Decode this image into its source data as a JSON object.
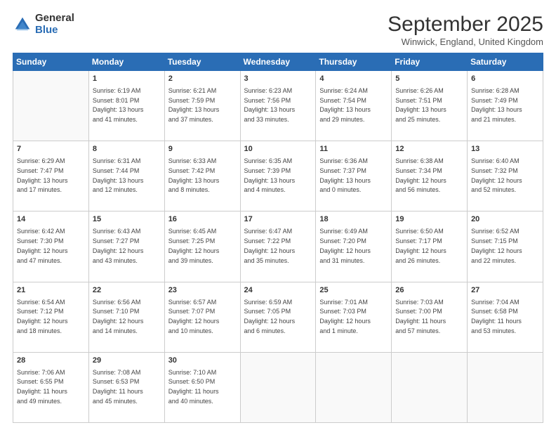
{
  "logo": {
    "general": "General",
    "blue": "Blue"
  },
  "header": {
    "month": "September 2025",
    "location": "Winwick, England, United Kingdom"
  },
  "days_header": [
    "Sunday",
    "Monday",
    "Tuesday",
    "Wednesday",
    "Thursday",
    "Friday",
    "Saturday"
  ],
  "weeks": [
    [
      {
        "day": "",
        "info": ""
      },
      {
        "day": "1",
        "info": "Sunrise: 6:19 AM\nSunset: 8:01 PM\nDaylight: 13 hours\nand 41 minutes."
      },
      {
        "day": "2",
        "info": "Sunrise: 6:21 AM\nSunset: 7:59 PM\nDaylight: 13 hours\nand 37 minutes."
      },
      {
        "day": "3",
        "info": "Sunrise: 6:23 AM\nSunset: 7:56 PM\nDaylight: 13 hours\nand 33 minutes."
      },
      {
        "day": "4",
        "info": "Sunrise: 6:24 AM\nSunset: 7:54 PM\nDaylight: 13 hours\nand 29 minutes."
      },
      {
        "day": "5",
        "info": "Sunrise: 6:26 AM\nSunset: 7:51 PM\nDaylight: 13 hours\nand 25 minutes."
      },
      {
        "day": "6",
        "info": "Sunrise: 6:28 AM\nSunset: 7:49 PM\nDaylight: 13 hours\nand 21 minutes."
      }
    ],
    [
      {
        "day": "7",
        "info": "Sunrise: 6:29 AM\nSunset: 7:47 PM\nDaylight: 13 hours\nand 17 minutes."
      },
      {
        "day": "8",
        "info": "Sunrise: 6:31 AM\nSunset: 7:44 PM\nDaylight: 13 hours\nand 12 minutes."
      },
      {
        "day": "9",
        "info": "Sunrise: 6:33 AM\nSunset: 7:42 PM\nDaylight: 13 hours\nand 8 minutes."
      },
      {
        "day": "10",
        "info": "Sunrise: 6:35 AM\nSunset: 7:39 PM\nDaylight: 13 hours\nand 4 minutes."
      },
      {
        "day": "11",
        "info": "Sunrise: 6:36 AM\nSunset: 7:37 PM\nDaylight: 13 hours\nand 0 minutes."
      },
      {
        "day": "12",
        "info": "Sunrise: 6:38 AM\nSunset: 7:34 PM\nDaylight: 12 hours\nand 56 minutes."
      },
      {
        "day": "13",
        "info": "Sunrise: 6:40 AM\nSunset: 7:32 PM\nDaylight: 12 hours\nand 52 minutes."
      }
    ],
    [
      {
        "day": "14",
        "info": "Sunrise: 6:42 AM\nSunset: 7:30 PM\nDaylight: 12 hours\nand 47 minutes."
      },
      {
        "day": "15",
        "info": "Sunrise: 6:43 AM\nSunset: 7:27 PM\nDaylight: 12 hours\nand 43 minutes."
      },
      {
        "day": "16",
        "info": "Sunrise: 6:45 AM\nSunset: 7:25 PM\nDaylight: 12 hours\nand 39 minutes."
      },
      {
        "day": "17",
        "info": "Sunrise: 6:47 AM\nSunset: 7:22 PM\nDaylight: 12 hours\nand 35 minutes."
      },
      {
        "day": "18",
        "info": "Sunrise: 6:49 AM\nSunset: 7:20 PM\nDaylight: 12 hours\nand 31 minutes."
      },
      {
        "day": "19",
        "info": "Sunrise: 6:50 AM\nSunset: 7:17 PM\nDaylight: 12 hours\nand 26 minutes."
      },
      {
        "day": "20",
        "info": "Sunrise: 6:52 AM\nSunset: 7:15 PM\nDaylight: 12 hours\nand 22 minutes."
      }
    ],
    [
      {
        "day": "21",
        "info": "Sunrise: 6:54 AM\nSunset: 7:12 PM\nDaylight: 12 hours\nand 18 minutes."
      },
      {
        "day": "22",
        "info": "Sunrise: 6:56 AM\nSunset: 7:10 PM\nDaylight: 12 hours\nand 14 minutes."
      },
      {
        "day": "23",
        "info": "Sunrise: 6:57 AM\nSunset: 7:07 PM\nDaylight: 12 hours\nand 10 minutes."
      },
      {
        "day": "24",
        "info": "Sunrise: 6:59 AM\nSunset: 7:05 PM\nDaylight: 12 hours\nand 6 minutes."
      },
      {
        "day": "25",
        "info": "Sunrise: 7:01 AM\nSunset: 7:03 PM\nDaylight: 12 hours\nand 1 minute."
      },
      {
        "day": "26",
        "info": "Sunrise: 7:03 AM\nSunset: 7:00 PM\nDaylight: 11 hours\nand 57 minutes."
      },
      {
        "day": "27",
        "info": "Sunrise: 7:04 AM\nSunset: 6:58 PM\nDaylight: 11 hours\nand 53 minutes."
      }
    ],
    [
      {
        "day": "28",
        "info": "Sunrise: 7:06 AM\nSunset: 6:55 PM\nDaylight: 11 hours\nand 49 minutes."
      },
      {
        "day": "29",
        "info": "Sunrise: 7:08 AM\nSunset: 6:53 PM\nDaylight: 11 hours\nand 45 minutes."
      },
      {
        "day": "30",
        "info": "Sunrise: 7:10 AM\nSunset: 6:50 PM\nDaylight: 11 hours\nand 40 minutes."
      },
      {
        "day": "",
        "info": ""
      },
      {
        "day": "",
        "info": ""
      },
      {
        "day": "",
        "info": ""
      },
      {
        "day": "",
        "info": ""
      }
    ]
  ]
}
